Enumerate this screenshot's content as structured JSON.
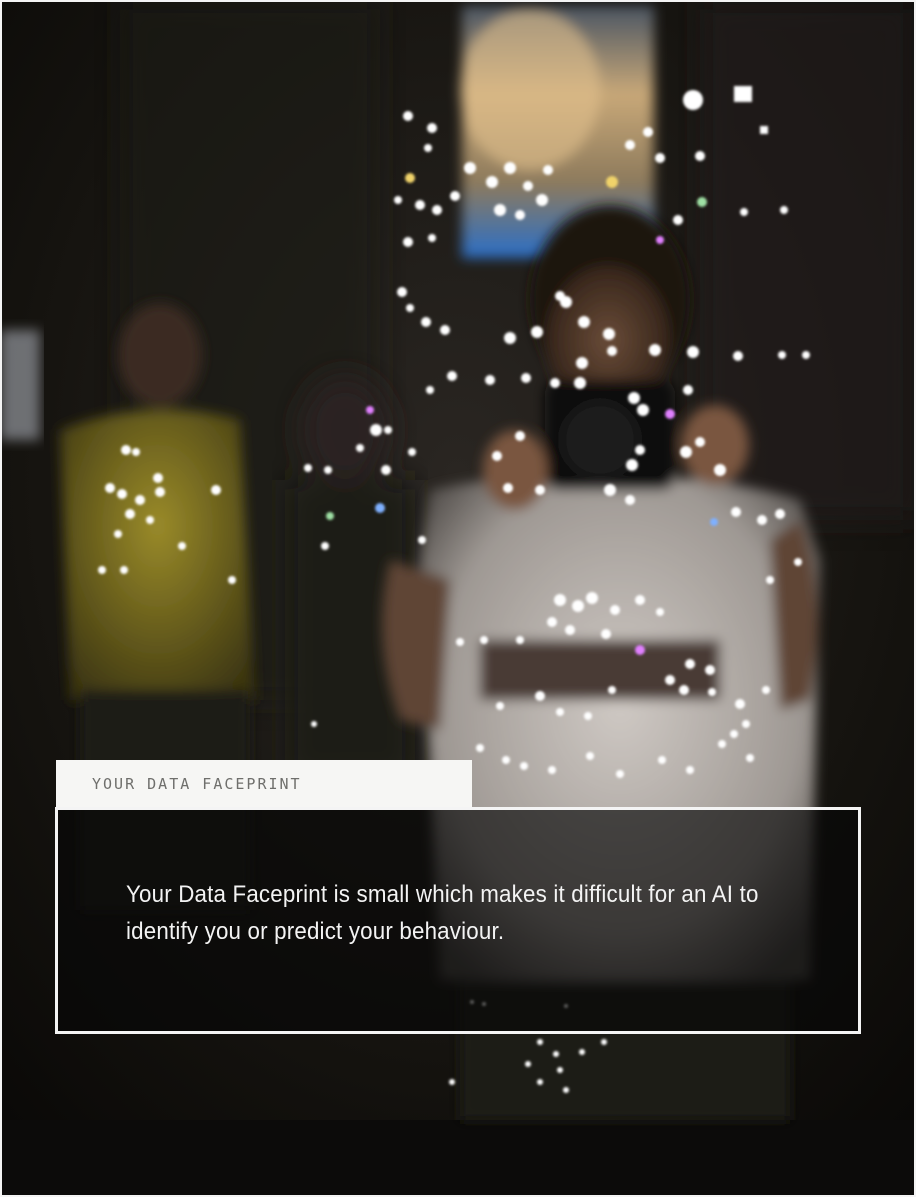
{
  "panel": {
    "heading": "YOUR DATA FACEPRINT",
    "message": "Your Data Faceprint is small which makes it difficult for an AI to identify you or predict your behaviour."
  },
  "colors": {
    "panel_border": "#f4f4f4",
    "tab_background": "#f6f6f4",
    "tab_text": "#6f6f6c",
    "message_text": "#f3f3f3"
  }
}
